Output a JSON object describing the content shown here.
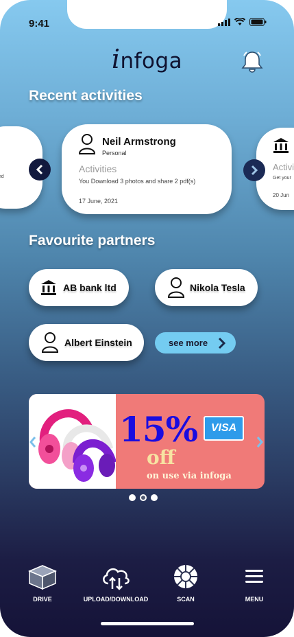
{
  "status": {
    "time": "9:41"
  },
  "header": {
    "logo_i": "i",
    "logo_rest": "nfoga"
  },
  "recent": {
    "title": "Recent activities",
    "left_card": {
      "snippet": "end"
    },
    "main_card": {
      "name": "Neil Armstrong",
      "type": "Personal",
      "heading": "Activities",
      "text": "You Download 3 photos and share 2 pdf(s)",
      "date": "17 June, 2021"
    },
    "right_card": {
      "heading": "Activi",
      "text": "Get your",
      "date": "20 Jun"
    }
  },
  "partners": {
    "title": "Favourite partners",
    "items": [
      {
        "label": "AB bank ltd",
        "icon": "bank-icon"
      },
      {
        "label": "Nikola Tesla",
        "icon": "person-icon"
      },
      {
        "label": "Albert Einstein",
        "icon": "person-icon"
      }
    ],
    "see_more": "see more"
  },
  "banner": {
    "discount": "15%",
    "off": "off",
    "subtitle": "on use via infoga",
    "card_brand": "VISA",
    "slides_total": 3,
    "active_slide": 2
  },
  "nav": {
    "items": [
      {
        "label": "DRIVE",
        "icon": "box-icon"
      },
      {
        "label": "UPLOAD/DOWNLOAD",
        "icon": "cloud-upload-download-icon"
      },
      {
        "label": "SCAN",
        "icon": "scan-icon"
      },
      {
        "label": "MENU",
        "icon": "hamburger-menu-icon"
      }
    ]
  },
  "colors": {
    "accent": "#74ccf1",
    "arrow_bg": "#12193e",
    "promo_bg": "#f07a78",
    "promo_text": "#1a0ce0"
  }
}
